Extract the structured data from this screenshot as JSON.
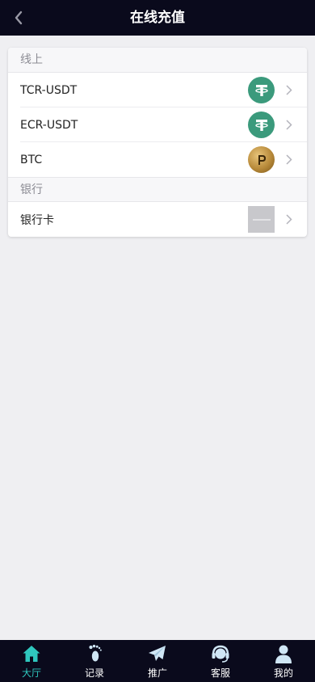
{
  "header": {
    "title": "在线充值"
  },
  "sections": [
    {
      "title": "线上",
      "items": [
        {
          "label": "TCR-USDT",
          "icon": "tether-icon"
        },
        {
          "label": "ECR-USDT",
          "icon": "tether-icon"
        },
        {
          "label": "BTC",
          "icon": "bitcoin-icon"
        }
      ]
    },
    {
      "title": "银行",
      "items": [
        {
          "label": "银行卡",
          "icon": "bank-card-icon"
        }
      ]
    }
  ],
  "tabbar": {
    "items": [
      {
        "label": "大厅",
        "icon": "home-icon",
        "active": true
      },
      {
        "label": "记录",
        "icon": "footprint-icon",
        "active": false
      },
      {
        "label": "推广",
        "icon": "paper-plane-icon",
        "active": false
      },
      {
        "label": "客服",
        "icon": "headset-icon",
        "active": false
      },
      {
        "label": "我的",
        "icon": "user-icon",
        "active": false
      }
    ]
  },
  "colors": {
    "header_bg": "#0a0a1c",
    "tab_active": "#2fc7be",
    "tether_green": "#3b9a7c"
  }
}
